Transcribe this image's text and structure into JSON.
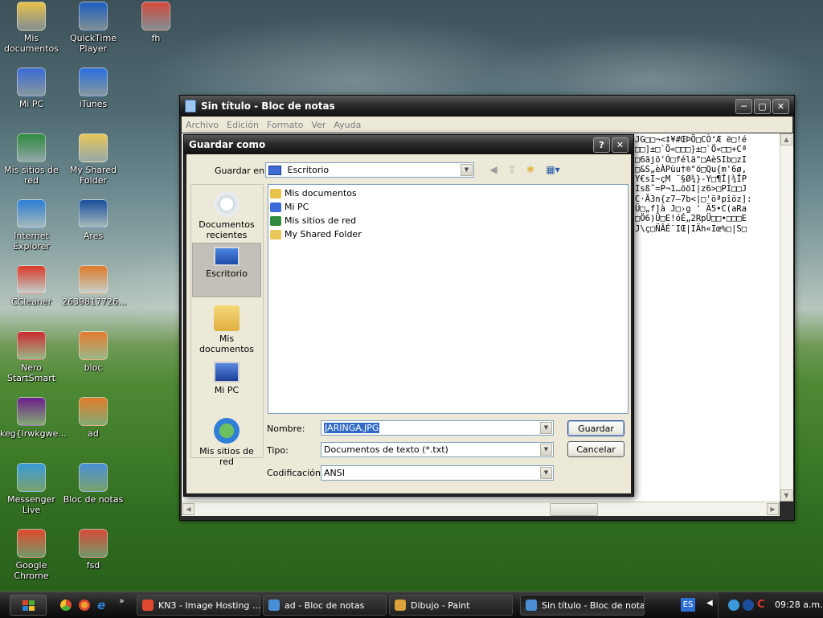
{
  "desktop": {
    "icons": [
      {
        "label": "Mis documentos",
        "icon": "my-documents-icon",
        "color": "#e8c24a"
      },
      {
        "label": "QuickTime Player",
        "icon": "quicktime-icon",
        "color": "#1e5fc2"
      },
      {
        "label": "fh",
        "icon": "image-file-icon",
        "color": "#d64a3a"
      },
      {
        "label": "Mi PC",
        "icon": "my-computer-icon",
        "color": "#3b6bd6"
      },
      {
        "label": "iTunes",
        "icon": "itunes-icon",
        "color": "#2a6fe0"
      },
      {
        "label": "Mis sitios de red",
        "icon": "network-places-icon",
        "color": "#2f8a3e"
      },
      {
        "label": "My Shared Folder",
        "icon": "folder-icon",
        "color": "#e9c75a"
      },
      {
        "label": "Internet Explorer",
        "icon": "internet-explorer-icon",
        "color": "#2d7fd3"
      },
      {
        "label": "Ares",
        "icon": "ares-icon",
        "color": "#1b4f9c"
      },
      {
        "label": "CCleaner",
        "icon": "ccleaner-icon",
        "color": "#d93a2a"
      },
      {
        "label": "2639817726...",
        "icon": "image-file-icon",
        "color": "#e07a2a"
      },
      {
        "label": "Nero StartSmart",
        "icon": "nero-icon",
        "color": "#c8282a"
      },
      {
        "label": "bloc",
        "icon": "image-file-icon",
        "color": "#e07a2a"
      },
      {
        "label": "keg{lrwkgwe...",
        "icon": "yahoo-icon",
        "color": "#6b1d8c"
      },
      {
        "label": "ad",
        "icon": "image-file-icon",
        "color": "#e07a2a"
      },
      {
        "label": "Messenger Live",
        "icon": "messenger-icon",
        "color": "#3a9ad9"
      },
      {
        "label": "Bloc de notas",
        "icon": "notepad-icon",
        "color": "#4a8fd6"
      },
      {
        "label": "Google Chrome",
        "icon": "chrome-icon",
        "color": "#e0492f"
      },
      {
        "label": "fsd",
        "icon": "image-file-icon",
        "color": "#d64a3a"
      }
    ]
  },
  "notepad": {
    "title": "Sin título - Bloc de notas",
    "menu": [
      "Archivo",
      "Edición",
      "Formato",
      "Ver",
      "Ayuda"
    ],
    "text_lines": [
      "JG□□¬<‡¥#ŒÞÖ□CÒ‘Æ ë□!é",
      "□□]±□`Ö«□□□}±□`Ö«□□+Cª",
      "□6ãjö'Ó□félä\"□AèSIb□zI",
      "□&S„èÀPùu†®°ö□Qu{m'6ø,",
      "Y€sI~çM ¨§Ø¾}-Y□¶Î|¾ÎP",
      "Isß˜=P¬1…ööI|z6>□PI□□J",
      "C·Ã3n{z7—7b<|□'öªpîöz]:",
      "Ü□„f]à J□›g ' Ã5•C(aRa",
      "□Ö6)Ü□E!óÉ„2RpÜ□□•□□□E",
      "J\\ç□ÑÂÉ¨IŒ|IÄh«Iœ%□|S□"
    ]
  },
  "dialog": {
    "title": "Guardar como",
    "help_label": "?",
    "save_in_label": "Guardar en:",
    "save_in_value": "Escritorio",
    "places": [
      {
        "label": "Documentos recientes",
        "icon": "recent-documents-icon"
      },
      {
        "label": "Escritorio",
        "icon": "desktop-icon"
      },
      {
        "label": "Mis documentos",
        "icon": "my-documents-icon"
      },
      {
        "label": "Mi PC",
        "icon": "my-computer-icon"
      },
      {
        "label": "Mis sitios de red",
        "icon": "network-places-icon"
      }
    ],
    "files": [
      {
        "name": "Mis documentos",
        "icon": "my-documents-icon",
        "color": "#e8c24a"
      },
      {
        "name": "Mi PC",
        "icon": "my-computer-icon",
        "color": "#3b6bd6"
      },
      {
        "name": "Mis sitios de red",
        "icon": "network-places-icon",
        "color": "#2f8a3e"
      },
      {
        "name": "My Shared Folder",
        "icon": "folder-icon",
        "color": "#e9c75a"
      }
    ],
    "name_label": "Nombre:",
    "name_value": "JARINGA.JPG",
    "type_label": "Tipo:",
    "type_value": "Documentos de texto (*.txt)",
    "encoding_label": "Codificación:",
    "encoding_value": "ANSI",
    "save_button": "Guardar",
    "cancel_button": "Cancelar"
  },
  "taskbar": {
    "tasks": [
      {
        "label": "KN3 - Image Hosting ...",
        "icon": "chrome-icon",
        "color": "#e0492f"
      },
      {
        "label": "ad - Bloc de notas",
        "icon": "notepad-icon",
        "color": "#4a8fd6"
      },
      {
        "label": "Dibujo - Paint",
        "icon": "paint-icon",
        "color": "#d9a23a"
      },
      {
        "label": "Sin título - Bloc de notas",
        "icon": "notepad-icon",
        "color": "#4a8fd6"
      }
    ],
    "language": "ES",
    "clock": "09:28 a.m.",
    "overflow": "»"
  },
  "colors": {
    "selection": "#316ac5",
    "accent": "#0a246a"
  }
}
